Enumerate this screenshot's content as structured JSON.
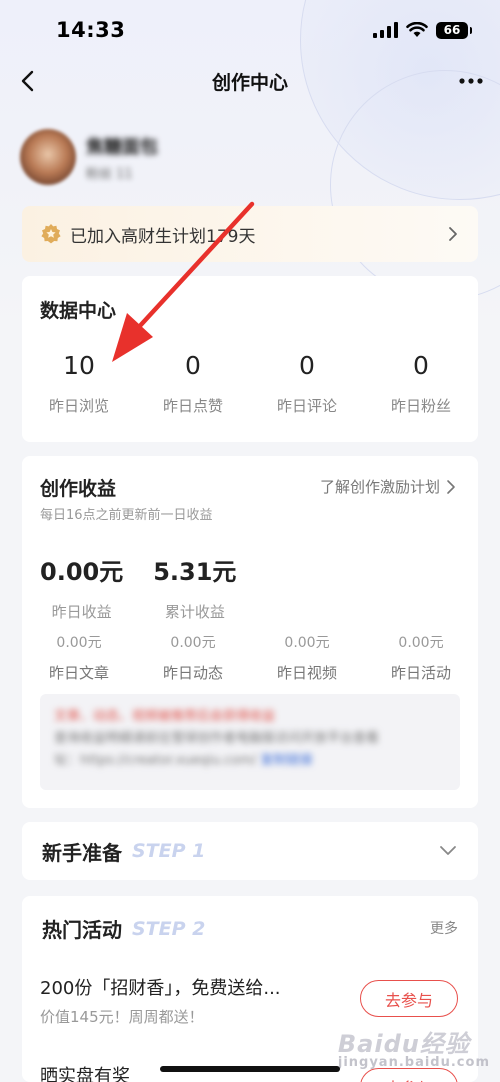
{
  "status_bar": {
    "time": "14:33",
    "battery": "66"
  },
  "nav": {
    "title": "创作中心"
  },
  "profile": {
    "name": "焦糖面包",
    "sub": "粉丝 11"
  },
  "plan_banner": {
    "text": "已加入高财生计划179天"
  },
  "data_center": {
    "title": "数据中心",
    "stats": [
      {
        "value": "10",
        "label": "昨日浏览"
      },
      {
        "value": "0",
        "label": "昨日点赞"
      },
      {
        "value": "0",
        "label": "昨日评论"
      },
      {
        "value": "0",
        "label": "昨日粉丝"
      }
    ]
  },
  "income": {
    "title": "创作收益",
    "link": "了解创作激励计划",
    "desc": "每日16点之前更新前一日收益",
    "big_stats": [
      {
        "value": "0.00元",
        "label": "昨日收益"
      },
      {
        "value": "5.31元",
        "label": "累计收益"
      }
    ],
    "small_stats": [
      {
        "value": "0.00元",
        "label": "昨日文章"
      },
      {
        "value": "0.00元",
        "label": "昨日动态"
      },
      {
        "value": "0.00元",
        "label": "昨日视频"
      },
      {
        "value": "0.00元",
        "label": "昨日活动"
      }
    ],
    "notice": {
      "line1": "文章、动态、视频被推荐后会获得收益",
      "line2": "查询收益明细请前往雪球创作者电脑版访问开放平台查看",
      "line3_prefix": "址：https://creator.xueqiu.com/",
      "line3_link": "复制链接"
    }
  },
  "newbie": {
    "title": "新手准备",
    "step": "STEP 1"
  },
  "activities": {
    "title": "热门活动",
    "step": "STEP 2",
    "more": "更多",
    "items": [
      {
        "title": "200份「招财香」，免费送给...",
        "sub": "价值145元！周周都送！",
        "button": "去参与"
      },
      {
        "title": "晒实盘有奖",
        "button": "去参与"
      }
    ]
  },
  "watermark": {
    "brand": "Baidu经验",
    "sub": "jingyan.baidu.com"
  },
  "colors": {
    "accent_red": "#e8504c",
    "arrow_red": "#e8312c",
    "step_tag": "#c9d3ee"
  }
}
